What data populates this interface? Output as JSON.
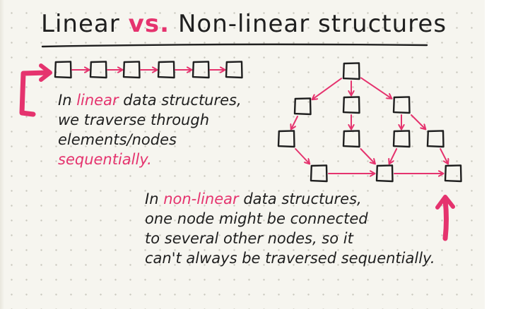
{
  "title": {
    "part1": "Linear",
    "vs": "vs.",
    "part2": "Non-linear structures"
  },
  "linear_note": {
    "line1_pre": "In",
    "line1_key": "linear",
    "line1_post": "data structures,",
    "line2": "we traverse through",
    "line3": "elements/nodes",
    "line4": "sequentially."
  },
  "nonlinear_note": {
    "line1_pre": "In",
    "line1_key": "non-linear",
    "line1_post": "data structures,",
    "line2": "one node might be connected",
    "line3": "to several other nodes, so it",
    "line4": "can't always be traversed sequentially."
  },
  "colors": {
    "ink": "#1f1f1f",
    "accent": "#e5336e",
    "paper": "#f6f5ef"
  }
}
